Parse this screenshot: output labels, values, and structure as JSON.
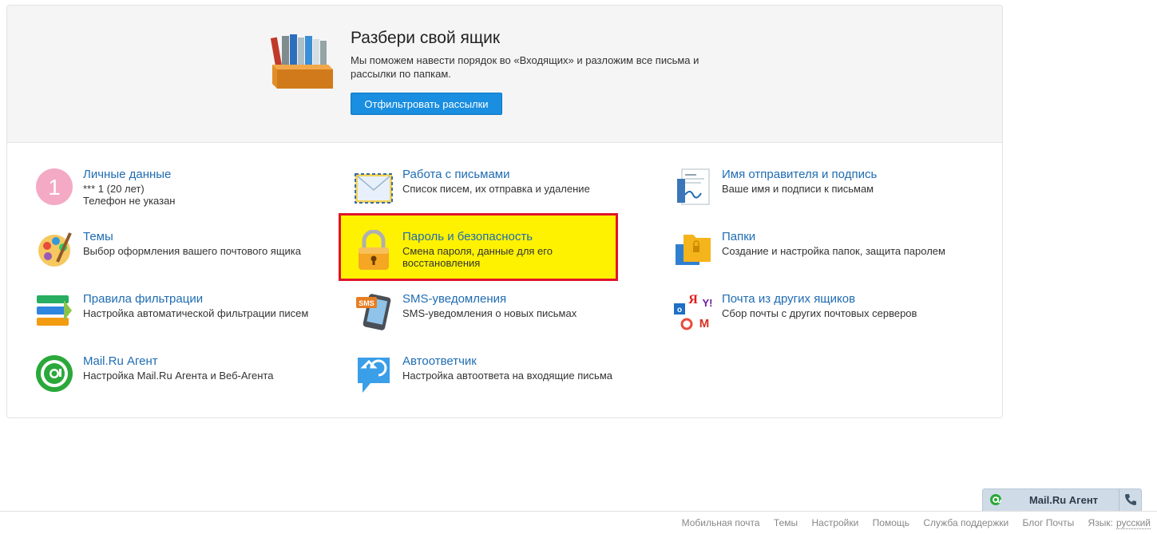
{
  "promo": {
    "title": "Разбери свой ящик",
    "description": "Мы поможем навести порядок во «Входящих» и разложим все письма и рассылки по папкам.",
    "button_label": "Отфильтровать рассылки"
  },
  "items": [
    {
      "title": "Личные данные",
      "desc_line1": "*** 1  (20 лет)",
      "desc_line2": "Телефон не указан",
      "icon": "avatar-number-icon",
      "avatar_digit": "1"
    },
    {
      "title": "Работа с письмами",
      "desc_line1": "Список писем, их отправка и удаление",
      "icon": "envelope-icon"
    },
    {
      "title": "Имя отправителя и подпись",
      "desc_line1": "Ваше имя и подписи к письмам",
      "icon": "signature-document-icon"
    },
    {
      "title": "Темы",
      "desc_line1": "Выбор оформления вашего почтового ящика",
      "icon": "palette-icon"
    },
    {
      "title": "Пароль и безопасность",
      "desc_line1": "Смена пароля, данные для его",
      "desc_line2": "восстановления",
      "icon": "padlock-icon"
    },
    {
      "title": "Папки",
      "desc_line1": "Создание и настройка папок, защита паролем",
      "icon": "folders-icon"
    },
    {
      "title": "Правила фильтрации",
      "desc_line1": "Настройка автоматической фильтрации писем",
      "icon": "filter-rules-icon"
    },
    {
      "title": "SMS-уведомления",
      "desc_line1": "SMS-уведомления о новых письмах",
      "icon": "sms-phone-icon",
      "sms_badge": "SMS"
    },
    {
      "title": "Почта из других ящиков",
      "desc_line1": "Сбор почты с других почтовых серверов",
      "icon": "mail-collector-icon",
      "ya_glyph": "Я",
      "yahoo_glyph": "Y!",
      "gmail_glyph": "M"
    },
    {
      "title": "Mail.Ru Агент",
      "desc_line1": "Настройка Mail.Ru Агента и Веб-Агента",
      "icon": "mailru-agent-icon"
    },
    {
      "title": "Автоответчик",
      "desc_line1": "Настройка автоответа на входящие письма",
      "icon": "autoreply-icon"
    }
  ],
  "footer": {
    "links": [
      "Мобильная почта",
      "Темы",
      "Настройки",
      "Помощь",
      "Служба поддержки",
      "Блог Почты"
    ],
    "lang_label": "Язык:",
    "lang_value": "русский"
  },
  "agent_bar": {
    "label": "Mail.Ru Агент",
    "icon_left": "at-icon",
    "icon_right": "phone-icon"
  },
  "colors": {
    "link": "#1f6cb2",
    "button": "#1a8ee0",
    "highlight_fill": "#fff200",
    "highlight_border": "#e0142a"
  }
}
